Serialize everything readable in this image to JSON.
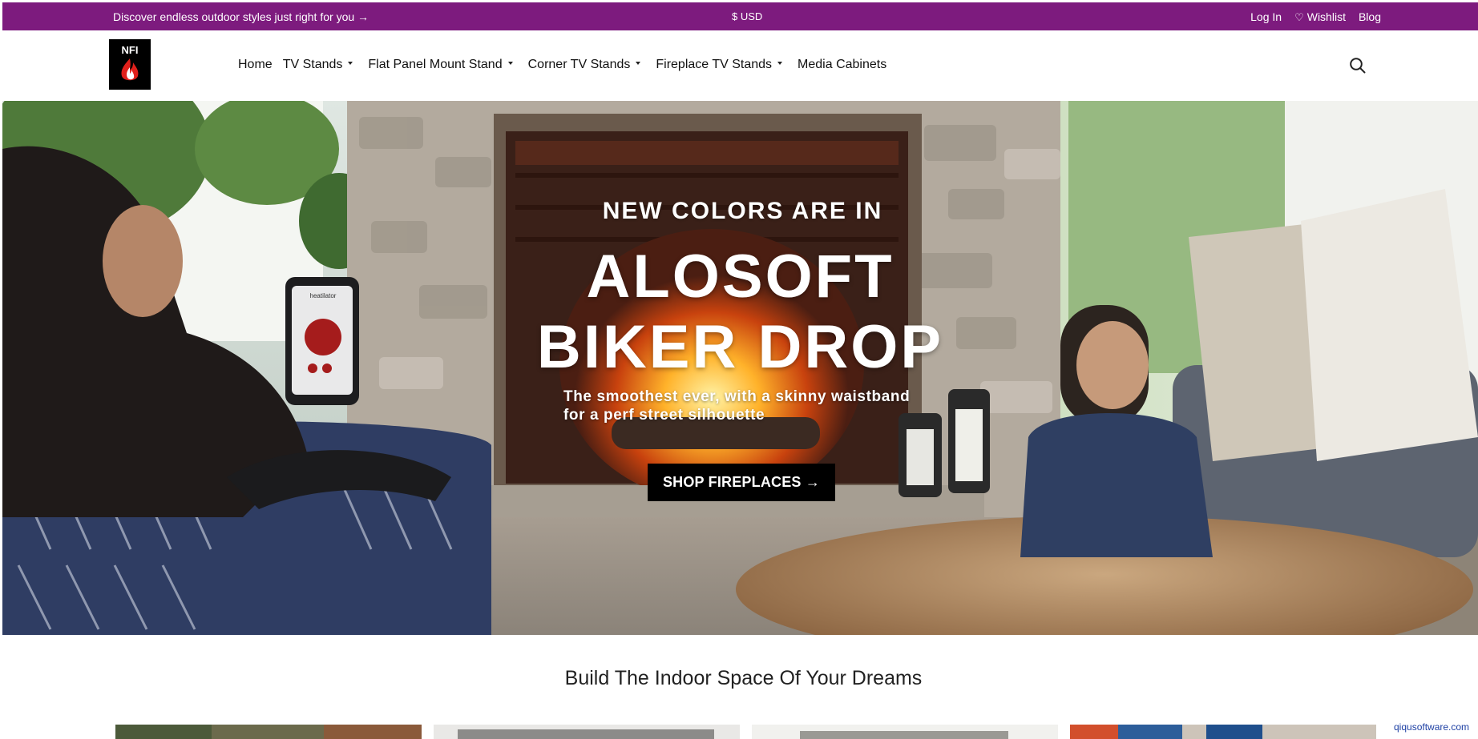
{
  "topbar": {
    "promo": "Discover endless outdoor styles just right for you →",
    "currency": "$ USD",
    "login": "Log In",
    "wishlist": "Wishlist",
    "blog": "Blog",
    "background": "#7d1b7e"
  },
  "header": {
    "logo_alt": "NFI",
    "nav": [
      {
        "label": "Home",
        "has_dropdown": false
      },
      {
        "label": "TV Stands",
        "has_dropdown": true
      },
      {
        "label": "Flat Panel Mount Stand",
        "has_dropdown": true
      },
      {
        "label": "Corner TV Stands",
        "has_dropdown": true
      },
      {
        "label": "Fireplace TV Stands",
        "has_dropdown": true
      },
      {
        "label": "Media Cabinets",
        "has_dropdown": false
      }
    ],
    "icons": [
      "search-icon",
      "heart-icon",
      "chevron-down-icon"
    ]
  },
  "hero": {
    "eyebrow": "NEW COLORS ARE IN",
    "headline_line1": "ALOSOFT",
    "headline_line2": "BIKER DROP",
    "subtitle_line1": "The smoothest ever, with a skinny waistband",
    "subtitle_line2": "for a perf street silhouette",
    "cta_label": "SHOP FIREPLACES →",
    "phone_app": "heatilator"
  },
  "section": {
    "title": "Build The Indoor Space Of Your Dreams",
    "cards": [
      "card-1",
      "card-2",
      "card-3",
      "card-4"
    ]
  },
  "watermark": "qiqusoftware.com"
}
